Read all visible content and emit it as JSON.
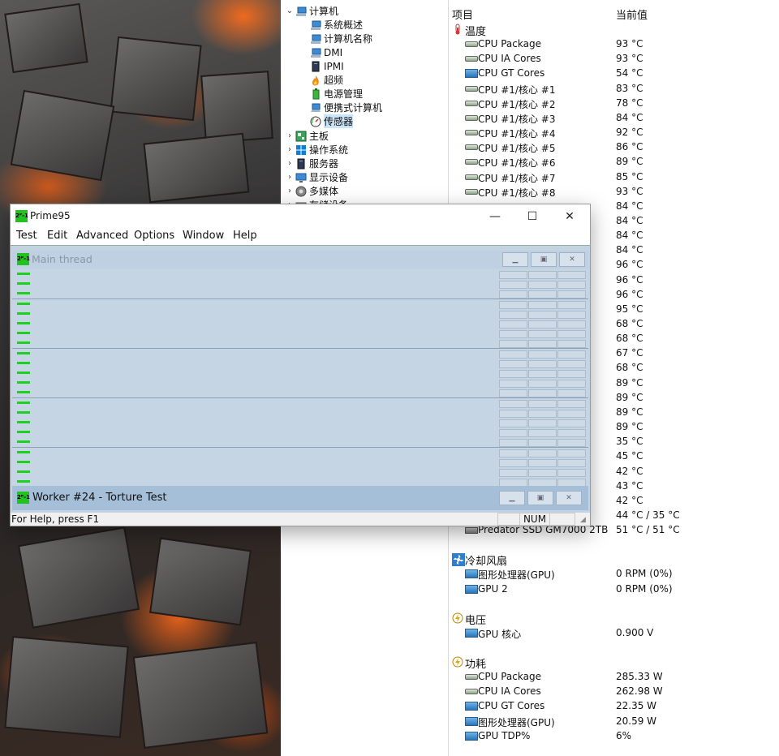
{
  "tree": {
    "items": [
      {
        "label": "计算机",
        "twisty": "⌄",
        "icon": "computer-icon"
      },
      {
        "label": "系统概述",
        "twisty": "",
        "icon": "computer-small-icon"
      },
      {
        "label": "计算机名称",
        "twisty": "",
        "icon": "computer-small-icon"
      },
      {
        "label": "DMI",
        "twisty": "",
        "icon": "computer-small-icon"
      },
      {
        "label": "IPMI",
        "twisty": "",
        "icon": "server-icon"
      },
      {
        "label": "超频",
        "twisty": "",
        "icon": "flame-icon"
      },
      {
        "label": "电源管理",
        "twisty": "",
        "icon": "battery-icon"
      },
      {
        "label": "便携式计算机",
        "twisty": "",
        "icon": "laptop-icon"
      },
      {
        "label": "传感器",
        "twisty": "",
        "icon": "gauge-icon"
      },
      {
        "label": "主板",
        "twisty": "›",
        "icon": "motherboard-icon"
      },
      {
        "label": "操作系统",
        "twisty": "›",
        "icon": "windows-icon"
      },
      {
        "label": "服务器",
        "twisty": "›",
        "icon": "server-icon"
      },
      {
        "label": "显示设备",
        "twisty": "›",
        "icon": "monitor-icon"
      },
      {
        "label": "多媒体",
        "twisty": "›",
        "icon": "speaker-icon"
      },
      {
        "label": "存储设备",
        "twisty": "›",
        "icon": "storage-icon"
      }
    ]
  },
  "sensor": {
    "header": {
      "item": "项目",
      "value": "当前值"
    },
    "temperature": {
      "label": "温度",
      "rows": [
        {
          "name": "CPU Package",
          "value": "93 °C",
          "icon": "chip-icon"
        },
        {
          "name": "CPU IA Cores",
          "value": "93 °C",
          "icon": "chip-icon"
        },
        {
          "name": "CPU GT Cores",
          "value": "54 °C",
          "icon": "monitor-icon"
        },
        {
          "name": "CPU #1/核心 #1",
          "value": "83 °C",
          "icon": "chip-icon"
        },
        {
          "name": "CPU #1/核心 #2",
          "value": "78 °C",
          "icon": "chip-icon"
        },
        {
          "name": "CPU #1/核心 #3",
          "value": "84 °C",
          "icon": "chip-icon"
        },
        {
          "name": "CPU #1/核心 #4",
          "value": "92 °C",
          "icon": "chip-icon"
        },
        {
          "name": "CPU #1/核心 #5",
          "value": "86 °C",
          "icon": "chip-icon"
        },
        {
          "name": "CPU #1/核心 #6",
          "value": "89 °C",
          "icon": "chip-icon"
        },
        {
          "name": "CPU #1/核心 #7",
          "value": "85 °C",
          "icon": "chip-icon"
        },
        {
          "name": "CPU #1/核心 #8",
          "value": "93 °C",
          "icon": "chip-icon"
        },
        {
          "name": "",
          "value": "84 °C",
          "icon": ""
        },
        {
          "name": "",
          "value": "84 °C",
          "icon": ""
        },
        {
          "name": "",
          "value": "84 °C",
          "icon": ""
        },
        {
          "name": "",
          "value": "84 °C",
          "icon": ""
        },
        {
          "name": "",
          "value": "96 °C",
          "icon": ""
        },
        {
          "name": "",
          "value": "96 °C",
          "icon": ""
        },
        {
          "name": "",
          "value": "96 °C",
          "icon": ""
        },
        {
          "name": "",
          "value": "95 °C",
          "icon": ""
        },
        {
          "name": "",
          "value": "68 °C",
          "icon": ""
        },
        {
          "name": "",
          "value": "68 °C",
          "icon": ""
        },
        {
          "name": "",
          "value": "67 °C",
          "icon": ""
        },
        {
          "name": "",
          "value": "68 °C",
          "icon": ""
        },
        {
          "name": "",
          "value": "89 °C",
          "icon": ""
        },
        {
          "name": "",
          "value": "89 °C",
          "icon": ""
        },
        {
          "name": "",
          "value": "89 °C",
          "icon": ""
        },
        {
          "name": "",
          "value": "89 °C",
          "icon": ""
        },
        {
          "name": "",
          "value": "35 °C",
          "icon": ""
        },
        {
          "name": "",
          "value": "45 °C",
          "icon": ""
        },
        {
          "name": "",
          "value": "42 °C",
          "icon": ""
        },
        {
          "name": "",
          "value": "43 °C",
          "icon": ""
        },
        {
          "name": "",
          "value": "42 °C",
          "icon": ""
        },
        {
          "name": "",
          "value": "44 °C / 35 °C",
          "icon": ""
        },
        {
          "name": "Predator SSD GM7000 2TB",
          "value": "51 °C / 51 °C",
          "icon": "ssd-icon"
        }
      ]
    },
    "fans": {
      "label": "冷却风扇",
      "rows": [
        {
          "name": "图形处理器(GPU)",
          "value": "0 RPM  (0%)",
          "icon": "monitor-icon"
        },
        {
          "name": "GPU 2",
          "value": "0 RPM  (0%)",
          "icon": "monitor-icon"
        }
      ]
    },
    "voltage": {
      "label": "电压",
      "rows": [
        {
          "name": "GPU 核心",
          "value": "0.900 V",
          "icon": "monitor-icon"
        }
      ]
    },
    "power": {
      "label": "功耗",
      "rows": [
        {
          "name": "CPU Package",
          "value": "285.33 W",
          "icon": "chip-icon"
        },
        {
          "name": "CPU IA Cores",
          "value": "262.98 W",
          "icon": "chip-icon"
        },
        {
          "name": "CPU GT Cores",
          "value": "22.35 W",
          "icon": "monitor-icon"
        },
        {
          "name": "图形处理器(GPU)",
          "value": "20.59 W",
          "icon": "monitor-icon"
        },
        {
          "name": "GPU TDP%",
          "value": "6%",
          "icon": "monitor-icon"
        }
      ]
    }
  },
  "prime95": {
    "title": "Prime95",
    "logo_text": "2ᴾ-1",
    "window_buttons": {
      "minimize": "—",
      "maximize": "☐",
      "close": "✕"
    },
    "menu": [
      "Test",
      "Edit",
      "Advanced",
      "Options",
      "Window",
      "Help"
    ],
    "main_thread_title": "Main thread",
    "worker_title": "Worker #24 - Torture Test",
    "worker_count": 24,
    "status": {
      "help": "For Help, press F1",
      "num": "NUM"
    },
    "accent": "#22c31e"
  }
}
